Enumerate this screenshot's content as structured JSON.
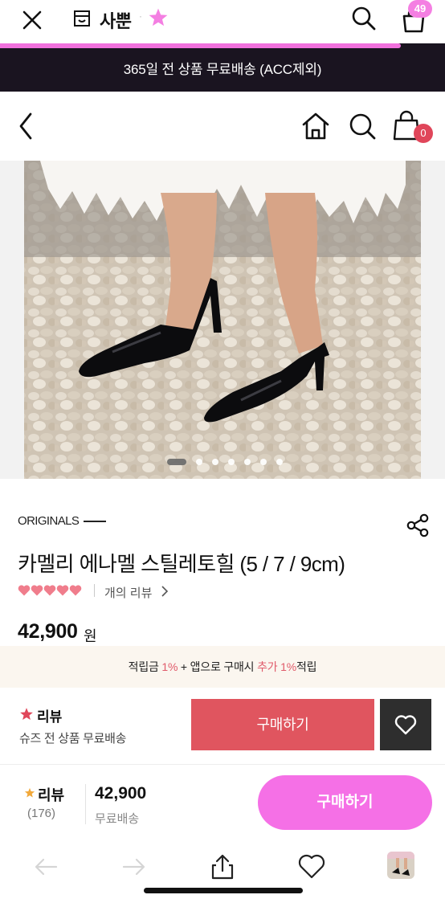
{
  "appbar": {
    "store_name": "사뿐",
    "separator": "·",
    "cart_count": "49",
    "progress_percent": 90,
    "icons": [
      "close-icon",
      "store-icon",
      "star-icon",
      "search-icon",
      "bag-icon"
    ]
  },
  "banner": {
    "text": "365일 전 상품 무료배송 (ACC제외)"
  },
  "shop_nav": {
    "cart_count": "0",
    "icons": [
      "back-icon",
      "home-icon",
      "search-icon",
      "shopping-bag-icon"
    ]
  },
  "gallery": {
    "image": "black patent pointed-toe stiletto pumps on pebble floor",
    "slide_count": 7,
    "active_index": 0
  },
  "product": {
    "brand": "ORIGINALS",
    "title": "카멜리 에나멜 스틸레토힐 (5 / 7 / 9cm)",
    "rating_hearts": 5,
    "review_link": "개의 리뷰",
    "price": "42,900",
    "currency": "원"
  },
  "points": {
    "p1": "적립금 ",
    "p1_pct": "1%",
    "p2": " + 앱으로 구매시 ",
    "p2_hl": "추가 1%",
    "p3": "적립"
  },
  "buy_bar": {
    "review_label": "리뷰",
    "shipping_note": "슈즈 전 상품 무료배송",
    "buy_label": "구매하기"
  },
  "app_buy_bar": {
    "review_label": "리뷰",
    "review_count": "(176)",
    "price": "42,900",
    "shipping": "무료배송",
    "buy_label": "구매하기"
  },
  "colors": {
    "accent_pink": "#f570e6",
    "buy_red": "#e0555f",
    "banner_dark": "#1a1420",
    "heart_pink": "#f07d8c"
  }
}
